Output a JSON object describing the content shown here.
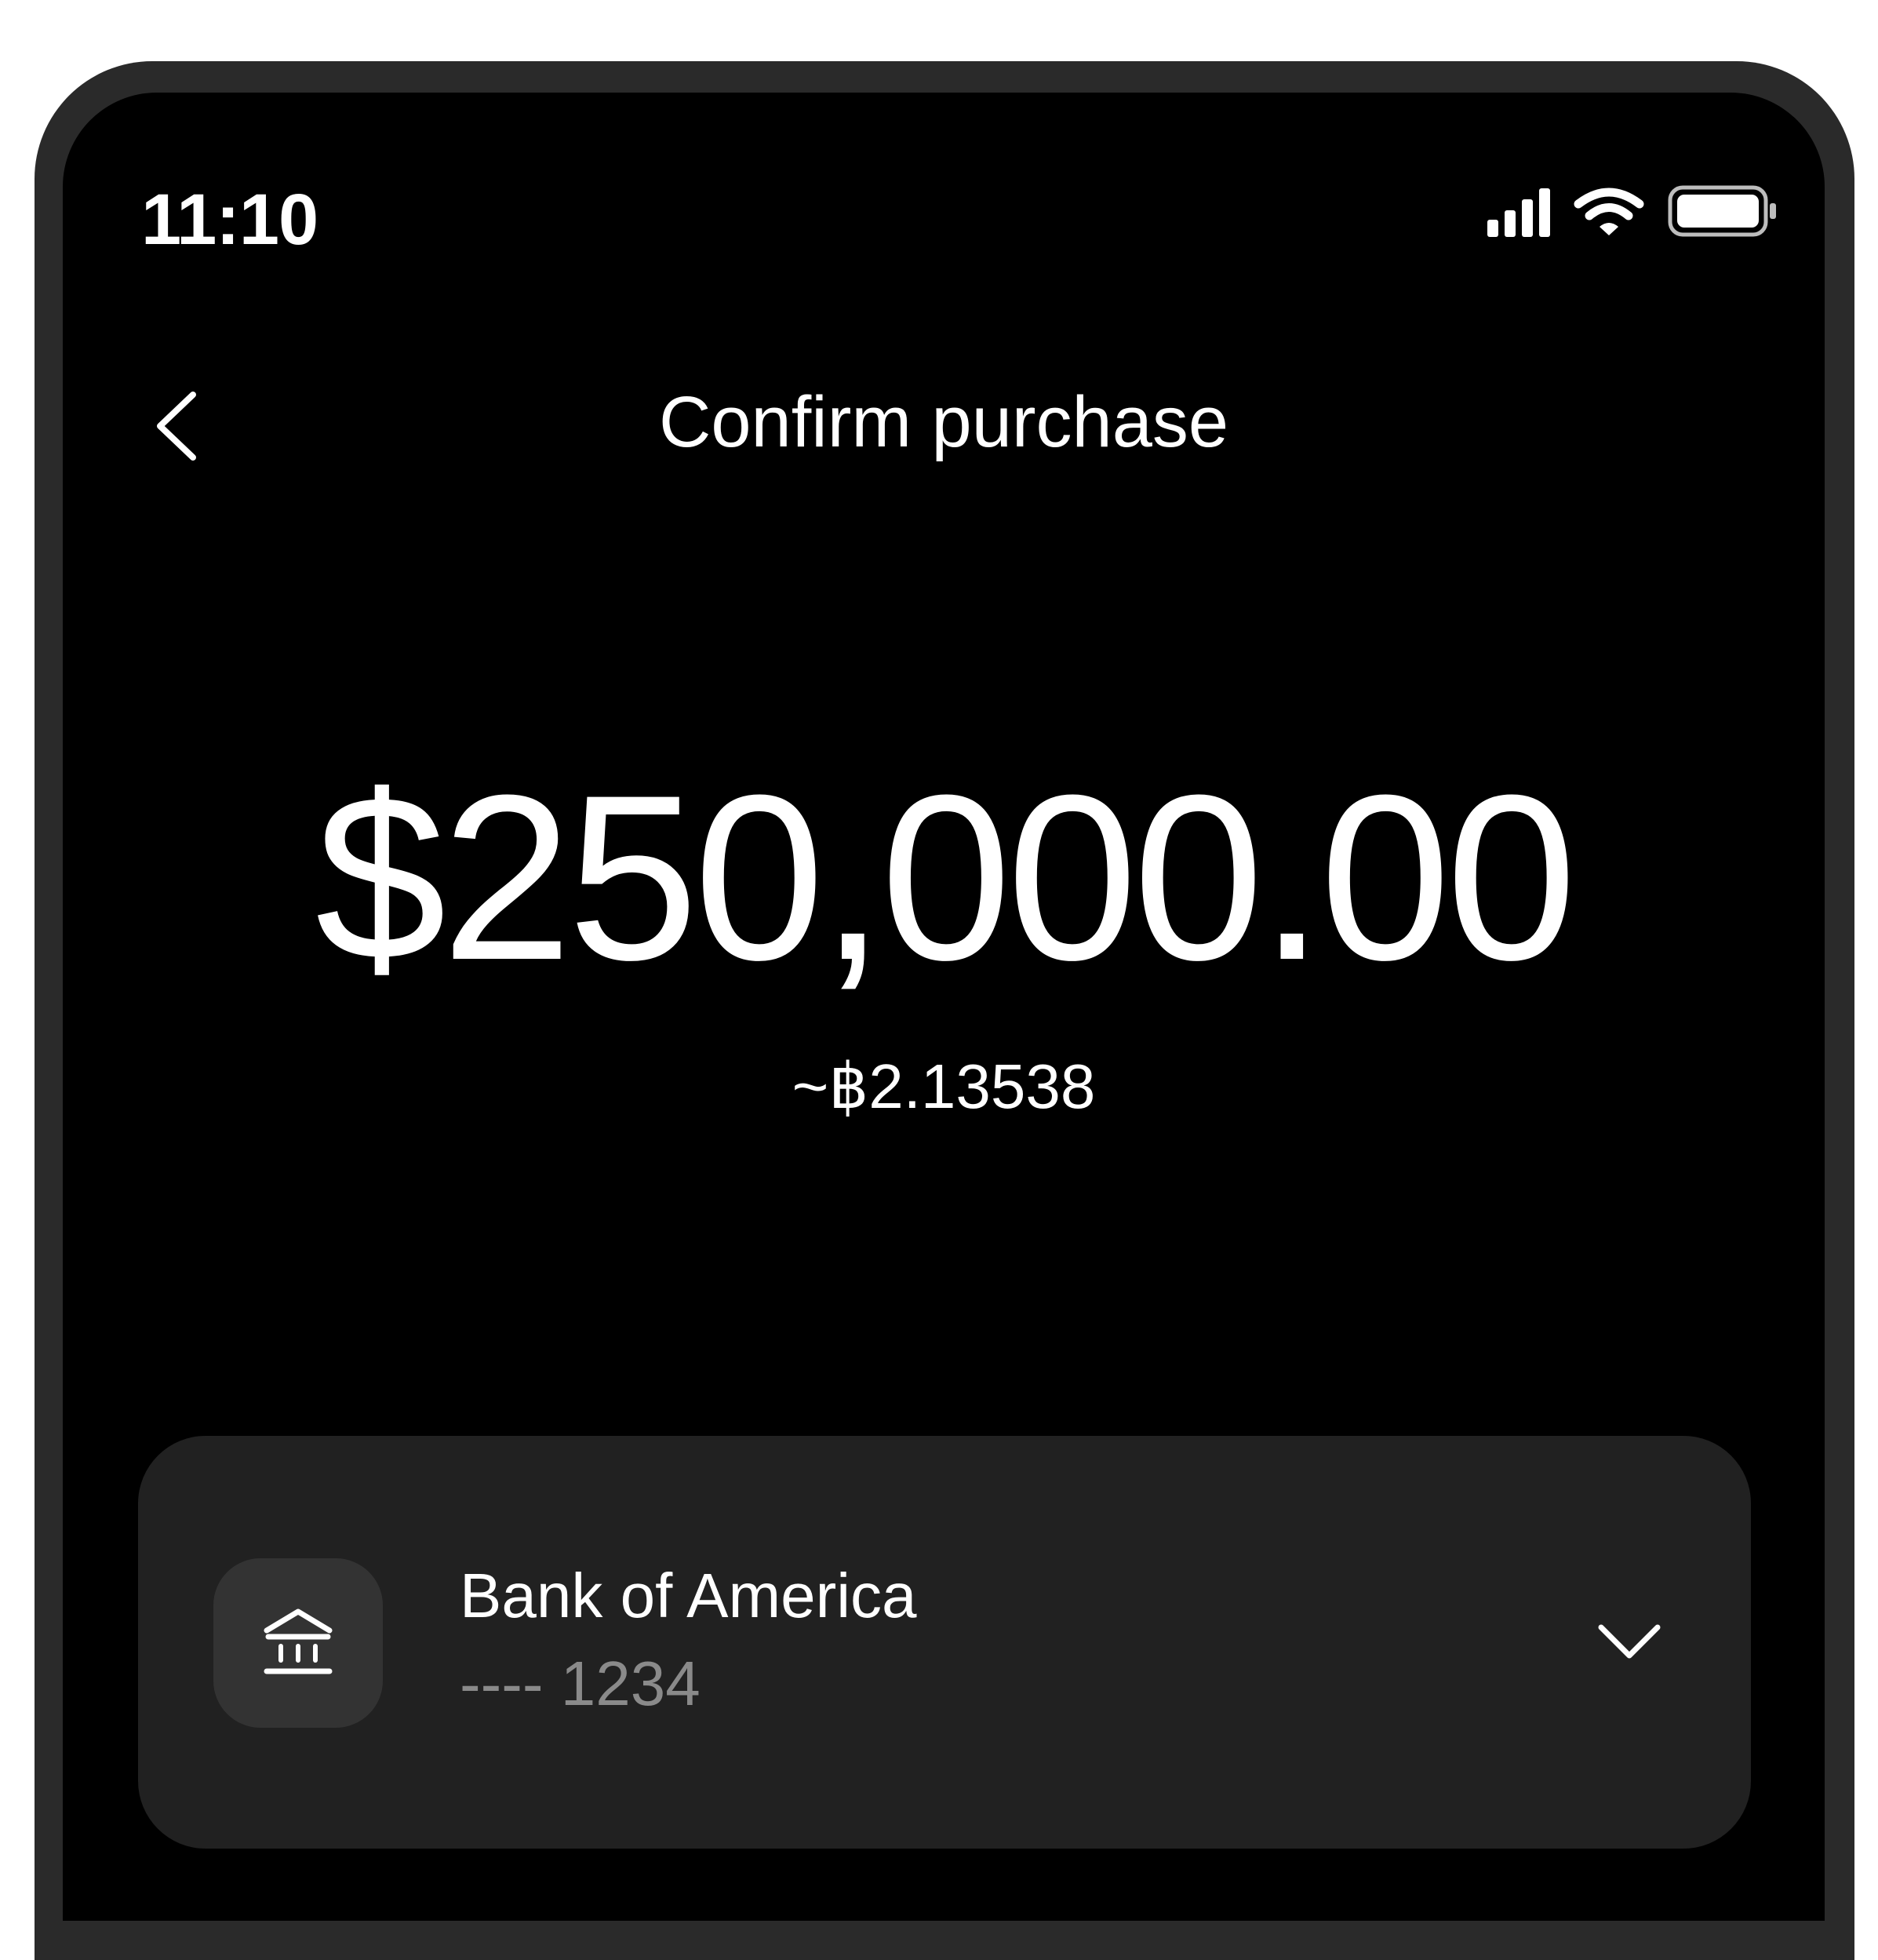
{
  "status_bar": {
    "time": "11:10",
    "icons": [
      "signal-icon",
      "wifi-icon",
      "battery-icon"
    ]
  },
  "header": {
    "title": "Confirm purchase",
    "back_icon": "chevron-left-icon"
  },
  "purchase": {
    "amount": "$250,000.00",
    "btc_equivalent": "~฿2.13538"
  },
  "payment_method": {
    "bank_name": "Bank of America",
    "account_number": "---- 1234",
    "icon": "bank-icon",
    "expand_icon": "chevron-down-icon"
  },
  "colors": {
    "background": "#000000",
    "card": "#212121",
    "icon_tile": "#333333",
    "text_primary": "#ffffff",
    "text_secondary": "#8a8a8a"
  }
}
